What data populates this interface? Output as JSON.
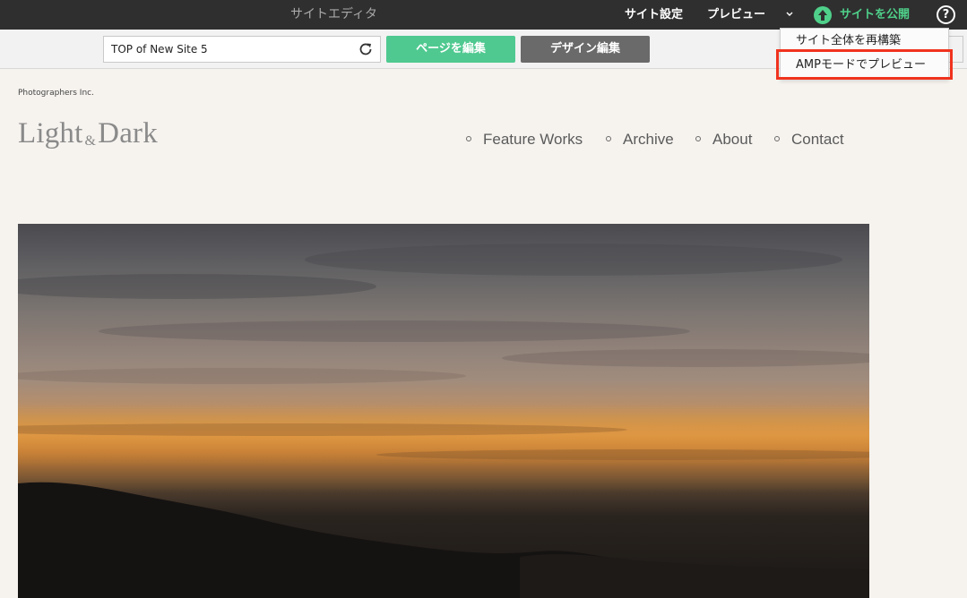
{
  "topbar": {
    "app_title": "サイトエディタ",
    "site_settings": "サイト設定",
    "preview": "プレビュー",
    "publish": "サイトを公開",
    "help": "?"
  },
  "toolbar": {
    "page_select_value": "TOP of New Site 5",
    "edit_page": "ページを編集",
    "edit_design": "デザイン編集"
  },
  "preview_menu": {
    "items": [
      "サイト全体を再構築",
      "AMPモードでプレビュー"
    ],
    "highlighted_index": 1
  },
  "site": {
    "brand_small": "Photographers Inc.",
    "logo_light": "Light",
    "logo_amp": "&",
    "logo_dark": "Dark",
    "nav": [
      "Feature Works",
      "Archive",
      "About",
      "Contact"
    ]
  },
  "colors": {
    "topbar_bg": "#2f2f2f",
    "publish_green": "#4fd08a",
    "edit_page_green": "#4fc990",
    "edit_design_gray": "#6a6a6a",
    "highlight_red": "#f0331e",
    "page_bg": "#f6f3ef"
  },
  "icons": [
    "chevron-down-icon",
    "upload-arrow-icon",
    "help-icon",
    "refresh-icon",
    "nav-bullet-icon"
  ]
}
